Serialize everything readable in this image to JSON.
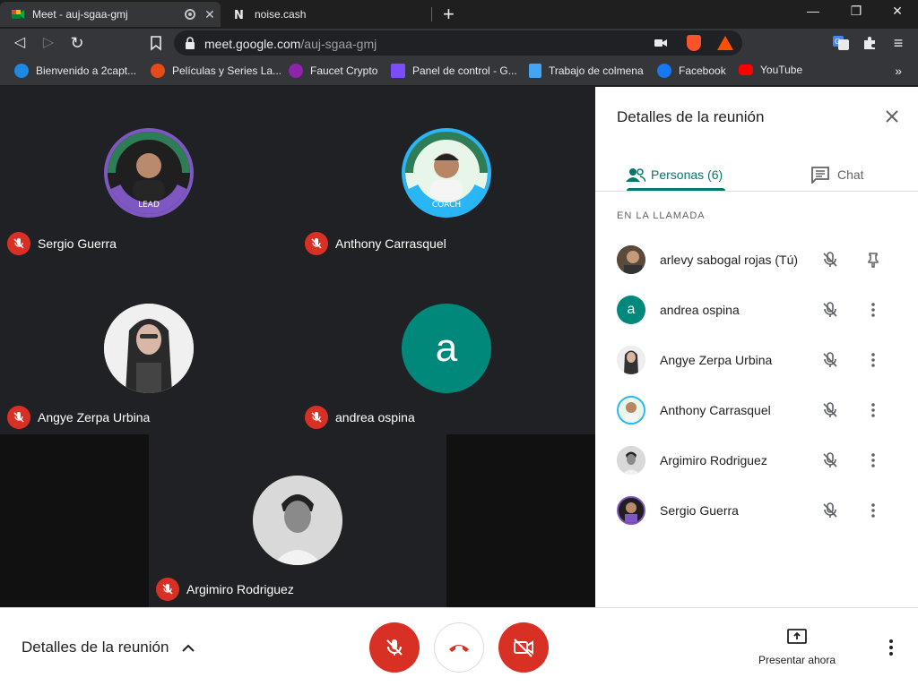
{
  "browser": {
    "tabs": [
      {
        "title": "Meet - auj-sgaa-gmj",
        "active": true
      },
      {
        "title": "noise.cash",
        "active": false
      }
    ],
    "new_tab": "+",
    "window_controls": {
      "minimize": "—",
      "restore": "❐",
      "close": "✕"
    },
    "nav": {
      "back": "◁",
      "forward": "▷",
      "reload": "↻",
      "menu": "≡"
    },
    "url": {
      "host": "meet.google.com",
      "path": "/auj-sgaa-gmj"
    },
    "bookmarks": [
      {
        "label": "Bienvenido a 2capt...",
        "color": "#1e88e5"
      },
      {
        "label": "Películas y Series La...",
        "color": "#e64a19"
      },
      {
        "label": "Faucet Crypto",
        "color": "#8e24aa"
      },
      {
        "label": "Panel de control - G...",
        "color": "#7c4dff"
      },
      {
        "label": "Trabajo de colmena",
        "color": "#42a5f5"
      },
      {
        "label": "Facebook",
        "color": "#1877f2"
      },
      {
        "label": "YouTube",
        "color": "#ff0000"
      }
    ],
    "bookmarks_more": "»"
  },
  "stage": {
    "tiles": [
      {
        "name": "Sergio Guerra",
        "avatar": "photo-lead-badge",
        "ring": "#7e57c2"
      },
      {
        "name": "Anthony Carrasquel",
        "avatar": "photo-coach-badge",
        "ring": "#29b6f6"
      },
      {
        "name": "Angye Zerpa Urbina",
        "avatar": "photo-woman",
        "ring": "#ffffff"
      },
      {
        "name": "andrea ospina",
        "avatar": "letter",
        "letter": "a",
        "color": "#00897b"
      },
      {
        "name": "Argimiro Rodriguez",
        "avatar": "photo-bw",
        "ring": "#888888"
      }
    ]
  },
  "panel": {
    "title": "Detalles de la reunión",
    "tabs": {
      "people": "Personas (6)",
      "chat": "Chat"
    },
    "section_label": "EN LA LLAMADA",
    "people": [
      {
        "name": "arlevy sabogal rojas (Tú)",
        "avatar": "photo",
        "action": "pin"
      },
      {
        "name": "andrea ospina",
        "avatar": "letter",
        "letter": "a",
        "action": "more"
      },
      {
        "name": "Angye Zerpa Urbina",
        "avatar": "photo",
        "action": "more"
      },
      {
        "name": "Anthony Carrasquel",
        "avatar": "photo",
        "action": "more"
      },
      {
        "name": "Argimiro Rodriguez",
        "avatar": "photo",
        "action": "more"
      },
      {
        "name": "Sergio Guerra",
        "avatar": "photo",
        "action": "more"
      }
    ]
  },
  "controls": {
    "details_label": "Detalles de la reunión",
    "present_label": "Presentar ahora"
  },
  "colors": {
    "meet_green": "#00796b",
    "danger": "#d93025",
    "stage_bg": "#202124"
  }
}
